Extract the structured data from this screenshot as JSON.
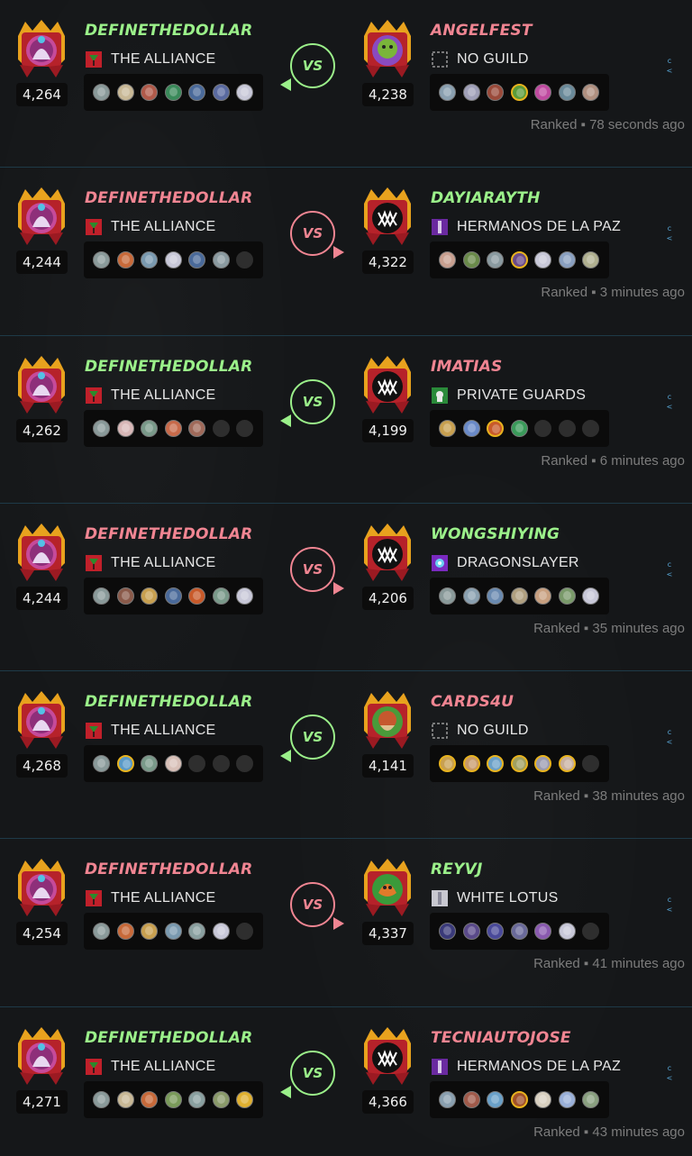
{
  "colors": {
    "winner": "#9bf08a",
    "loser": "#f08592",
    "background": "#151719",
    "divider": "#1e3a48"
  },
  "battles": [
    {
      "left": {
        "name": "DEFINETHEDOLLAR",
        "result": "win",
        "rating": "4,264",
        "guild": "THE ALLIANCE",
        "guild_icon": "red-banner-icon",
        "avatar": "wizard-avatar-icon",
        "cards": [
          {
            "c": "#8a9a9a"
          },
          {
            "c": "#c8b896"
          },
          {
            "c": "#b05a4a"
          },
          {
            "c": "#3a8a5a"
          },
          {
            "c": "#4a6a9a"
          },
          {
            "c": "#5a6aa0"
          },
          {
            "c": "#c8c8d8"
          }
        ]
      },
      "right": {
        "name": "ANGELFEST",
        "result": "lose",
        "rating": "4,238",
        "guild": "NO GUILD",
        "guild_icon": "empty-banner-icon",
        "avatar": "goblin-avatar-icon",
        "cards": [
          {
            "c": "#8aa0b0"
          },
          {
            "c": "#a0a0b8"
          },
          {
            "c": "#9a4a3a"
          },
          {
            "c": "#5a9a3a",
            "g": 1
          },
          {
            "c": "#c04aa0"
          },
          {
            "c": "#6a8a9a"
          },
          {
            "c": "#b09080"
          }
        ]
      },
      "winner_side": "left",
      "vs": "VS",
      "ranked": "Ranked ▪ 78 seconds ago"
    },
    {
      "left": {
        "name": "DEFINETHEDOLLAR",
        "result": "lose",
        "rating": "4,244",
        "guild": "THE ALLIANCE",
        "guild_icon": "red-banner-icon",
        "avatar": "wizard-avatar-icon",
        "cards": [
          {
            "c": "#8a9a9a"
          },
          {
            "c": "#c86a3a"
          },
          {
            "c": "#7a9ab0"
          },
          {
            "c": "#c8c8d8"
          },
          {
            "c": "#4a6a9a"
          },
          {
            "c": "#8a9aa0"
          },
          {
            "e": 1
          }
        ]
      },
      "right": {
        "name": "DAYIARAYTH",
        "result": "win",
        "rating": "4,322",
        "guild": "HERMANOS DE LA PAZ",
        "guild_icon": "purple-banner-icon",
        "avatar": "monster-avatar-icon",
        "cards": [
          {
            "c": "#c8a090"
          },
          {
            "c": "#6a8a4a"
          },
          {
            "c": "#8a9aa0"
          },
          {
            "c": "#6a4a8a",
            "g": 1
          },
          {
            "c": "#c8c8d8"
          },
          {
            "c": "#8aa0c0"
          },
          {
            "c": "#b0b090"
          }
        ]
      },
      "winner_side": "right",
      "vs": "VS",
      "ranked": "Ranked ▪ 3 minutes ago"
    },
    {
      "left": {
        "name": "DEFINETHEDOLLAR",
        "result": "win",
        "rating": "4,262",
        "guild": "THE ALLIANCE",
        "guild_icon": "red-banner-icon",
        "avatar": "wizard-avatar-icon",
        "cards": [
          {
            "c": "#8a9a9a"
          },
          {
            "c": "#d8b8b8"
          },
          {
            "c": "#7a9a8a"
          },
          {
            "c": "#c86a4a"
          },
          {
            "c": "#a06a5a"
          },
          {
            "e": 1
          },
          {
            "e": 1
          }
        ]
      },
      "right": {
        "name": "IMATIAS",
        "result": "lose",
        "rating": "4,199",
        "guild": "PRIVATE GUARDS",
        "guild_icon": "green-banner-icon",
        "avatar": "monster-avatar-icon",
        "cards": [
          {
            "c": "#c8a050"
          },
          {
            "c": "#6a8ac8"
          },
          {
            "c": "#c85a2a",
            "g": 1
          },
          {
            "c": "#3a9a5a"
          },
          {
            "e": 1
          },
          {
            "e": 1
          },
          {
            "e": 1
          }
        ]
      },
      "winner_side": "left",
      "vs": "VS",
      "ranked": "Ranked ▪ 6 minutes ago"
    },
    {
      "left": {
        "name": "DEFINETHEDOLLAR",
        "result": "lose",
        "rating": "4,244",
        "guild": "THE ALLIANCE",
        "guild_icon": "red-banner-icon",
        "avatar": "wizard-avatar-icon",
        "cards": [
          {
            "c": "#8a9a9a"
          },
          {
            "c": "#8a5a4a"
          },
          {
            "c": "#c8a050"
          },
          {
            "c": "#4a6a9a"
          },
          {
            "c": "#c85a2a"
          },
          {
            "c": "#7a9a8a"
          },
          {
            "c": "#c8c8d8"
          }
        ]
      },
      "right": {
        "name": "WONGSHIYING",
        "result": "win",
        "rating": "4,206",
        "guild": "DRAGONSLAYER",
        "guild_icon": "blue-banner-icon",
        "avatar": "monster-avatar-icon",
        "cards": [
          {
            "c": "#8a9a9a"
          },
          {
            "c": "#8aa0b0"
          },
          {
            "c": "#6a8ab0"
          },
          {
            "c": "#b0a080"
          },
          {
            "c": "#c8a080"
          },
          {
            "c": "#7a9a6a"
          },
          {
            "c": "#c8c8d8"
          }
        ]
      },
      "winner_side": "right",
      "vs": "VS",
      "ranked": "Ranked ▪ 35 minutes ago"
    },
    {
      "left": {
        "name": "DEFINETHEDOLLAR",
        "result": "win",
        "rating": "4,268",
        "guild": "THE ALLIANCE",
        "guild_icon": "red-banner-icon",
        "avatar": "wizard-avatar-icon",
        "cards": [
          {
            "c": "#8a9a9a"
          },
          {
            "c": "#5a9ac8",
            "g": 1
          },
          {
            "c": "#7a9a8a"
          },
          {
            "c": "#d8c0b8"
          },
          {
            "e": 1
          },
          {
            "e": 1
          },
          {
            "e": 1
          }
        ]
      },
      "right": {
        "name": "CARDS4U",
        "result": "lose",
        "rating": "4,141",
        "guild": "NO GUILD",
        "guild_icon": "empty-banner-icon",
        "avatar": "dwarf-avatar-icon",
        "cards": [
          {
            "c": "#c8a050",
            "g": 1
          },
          {
            "c": "#c89a6a",
            "g": 1
          },
          {
            "c": "#6aa0c8",
            "g": 1
          },
          {
            "c": "#a0a060",
            "g": 1
          },
          {
            "c": "#9a9ab0",
            "g": 1
          },
          {
            "c": "#c8b0a0",
            "g": 1
          },
          {
            "e": 1
          }
        ]
      },
      "winner_side": "left",
      "vs": "VS",
      "ranked": "Ranked ▪ 38 minutes ago"
    },
    {
      "left": {
        "name": "DEFINETHEDOLLAR",
        "result": "lose",
        "rating": "4,254",
        "guild": "THE ALLIANCE",
        "guild_icon": "red-banner-icon",
        "avatar": "wizard-avatar-icon",
        "cards": [
          {
            "c": "#8a9a9a"
          },
          {
            "c": "#c86a3a"
          },
          {
            "c": "#c8a050"
          },
          {
            "c": "#7a9ab0"
          },
          {
            "c": "#8aa0a0"
          },
          {
            "c": "#c8c8d8"
          },
          {
            "e": 1
          }
        ]
      },
      "right": {
        "name": "REYVJ",
        "result": "win",
        "rating": "4,337",
        "guild": "WHITE LOTUS",
        "guild_icon": "white-banner-icon",
        "avatar": "dragon-avatar-icon",
        "cards": [
          {
            "c": "#3a3a7a"
          },
          {
            "c": "#5a4a8a"
          },
          {
            "c": "#4a4a9a"
          },
          {
            "c": "#6a6a9a"
          },
          {
            "c": "#8a5ab0"
          },
          {
            "c": "#c8c8d8"
          },
          {
            "e": 1
          }
        ]
      },
      "winner_side": "right",
      "vs": "VS",
      "ranked": "Ranked ▪ 41 minutes ago"
    },
    {
      "left": {
        "name": "DEFINETHEDOLLAR",
        "result": "win",
        "rating": "4,271",
        "guild": "THE ALLIANCE",
        "guild_icon": "red-banner-icon",
        "avatar": "wizard-avatar-icon",
        "cards": [
          {
            "c": "#8a9a9a"
          },
          {
            "c": "#c8b896"
          },
          {
            "c": "#c86a3a"
          },
          {
            "c": "#7a9a5a"
          },
          {
            "c": "#8aa0a0"
          },
          {
            "c": "#8a9a6a"
          },
          {
            "c": "#e0b030"
          }
        ]
      },
      "right": {
        "name": "TECNIAUTOJOSE",
        "result": "lose",
        "rating": "4,366",
        "guild": "HERMANOS DE LA PAZ",
        "guild_icon": "purple-banner-icon",
        "avatar": "monster-avatar-icon",
        "cards": [
          {
            "c": "#8aa0b0"
          },
          {
            "c": "#a05a4a"
          },
          {
            "c": "#6aa0c8"
          },
          {
            "c": "#a0502a",
            "g": 1
          },
          {
            "c": "#d8d0c0"
          },
          {
            "c": "#9ab0d8"
          },
          {
            "c": "#8aa080"
          }
        ]
      },
      "winner_side": "left",
      "vs": "VS",
      "ranked": "Ranked ▪ 43 minutes ago"
    }
  ]
}
